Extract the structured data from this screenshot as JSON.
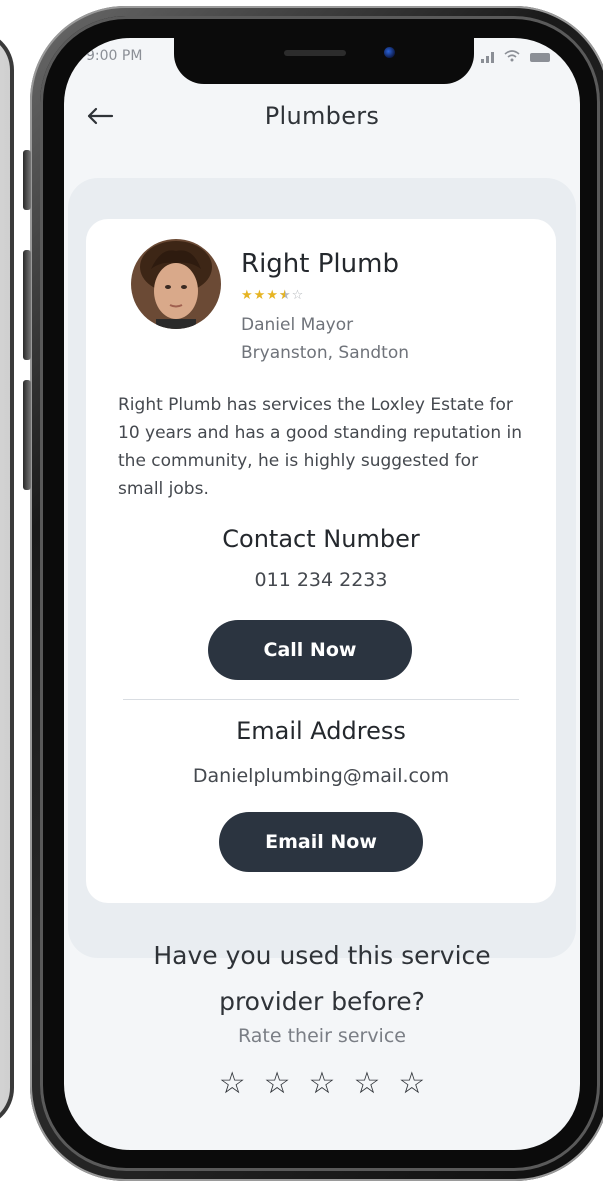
{
  "status_bar": {
    "time": "9:00 PM"
  },
  "header": {
    "title": "Plumbers",
    "back_icon": "arrow-left-icon"
  },
  "provider": {
    "business_name": "Right Plumb",
    "rating": 3.5,
    "rating_max": 5,
    "owner": "Daniel Mayor",
    "location": "Bryanston, Sandton",
    "description": "Right Plumb has services the Loxley Estate for 10 years and has a good standing reputation in the community, he is highly suggested for small jobs."
  },
  "contact": {
    "title": "Contact Number",
    "value": "011 234 2233",
    "button_label": "Call Now"
  },
  "email": {
    "title": "Email Address",
    "value": "Danielplumbing@mail.com",
    "button_label": "Email Now"
  },
  "rate": {
    "question": "Have you used this service provider before?",
    "subtitle": "Rate their service",
    "star_count": 5
  },
  "colors": {
    "button_bg": "#2b3440",
    "star_gold": "#e6b423",
    "panel_bg": "#e9edf1",
    "screen_bg": "#f4f6f8"
  }
}
